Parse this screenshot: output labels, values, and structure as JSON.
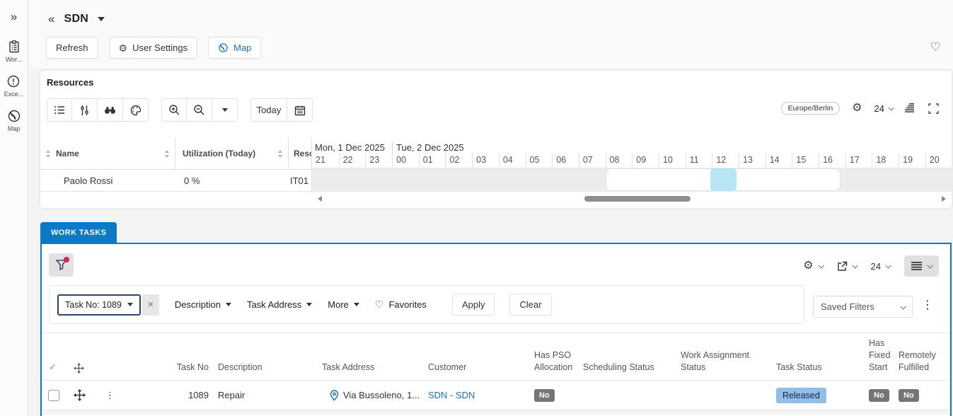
{
  "icons": {
    "expand": "»",
    "back": "«",
    "gear": "⚙",
    "heart": "♡",
    "kebab": "⋮",
    "close": "×",
    "checkmark": "✓"
  },
  "app": {
    "title": "SDN"
  },
  "sidebar": {
    "items": [
      {
        "icon": "clipboard-icon",
        "label": "Wor..."
      },
      {
        "icon": "alert-circle-icon",
        "label": "Exce..."
      },
      {
        "icon": "globe-icon",
        "label": "Map"
      }
    ]
  },
  "header": {
    "buttons": {
      "refresh": "Refresh",
      "user_settings": "User Settings",
      "map": "Map"
    }
  },
  "resources": {
    "title": "Resources",
    "today_label": "Today",
    "timezone": "Europe/Berlin",
    "zoom_level": "24",
    "grid": {
      "columns": [
        "Name",
        "Utilization (Today)",
        "Reso"
      ],
      "rows": [
        {
          "name": "Paolo Rossi",
          "utilization": "0 %",
          "resource_id": "IT01"
        }
      ]
    },
    "timeline": {
      "days": [
        {
          "label": "Mon, 1 Dec 2025"
        },
        {
          "label": "Tue, 2 Dec 2025"
        }
      ],
      "hours": [
        "21",
        "22",
        "23",
        "00",
        "01",
        "02",
        "03",
        "04",
        "05",
        "06",
        "07",
        "08",
        "09",
        "10",
        "11",
        "12",
        "13",
        "14",
        "15",
        "16",
        "17",
        "18",
        "19",
        "20"
      ]
    },
    "gantt": {
      "availability_band": {
        "from": "08:00",
        "to": "17:00"
      },
      "highlight_cell": "12:00"
    }
  },
  "work_tasks": {
    "tab_label": "WORK TASKS",
    "toolbar": {
      "zoom_level": "24"
    },
    "filters": {
      "active_chip": "Task No: 1089",
      "dropdowns": [
        "Description",
        "Task Address",
        "More"
      ],
      "favorites_label": "Favorites",
      "apply_label": "Apply",
      "clear_label": "Clear",
      "saved_filters_label": "Saved Filters"
    },
    "table": {
      "columns": [
        "Task No",
        "Description",
        "Task Address",
        "Customer",
        "Has PSO Allocation",
        "Scheduling Status",
        "Work Assignment Status",
        "Task Status",
        "Has Fixed Start",
        "Remotely Fulfilled"
      ],
      "rows": [
        {
          "task_no": "1089",
          "description": "Repair",
          "task_address": "Via Bussoleno, 1...",
          "customer": "SDN - SDN",
          "has_pso_allocation": "No",
          "scheduling_status": "",
          "work_assignment_status": "",
          "task_status": "Released",
          "has_fixed_start": "No",
          "remotely_fulfilled": "No"
        }
      ]
    }
  },
  "colors": {
    "primary_blue": "#0a7ac8",
    "link_blue": "#2170b8",
    "badge_gray": "#757575",
    "badge_released_bg": "#92bde9",
    "gantt_highlight": "#b7e5f3",
    "filter_alert_red": "#cf2749",
    "chip_border_navy": "#27476e"
  }
}
